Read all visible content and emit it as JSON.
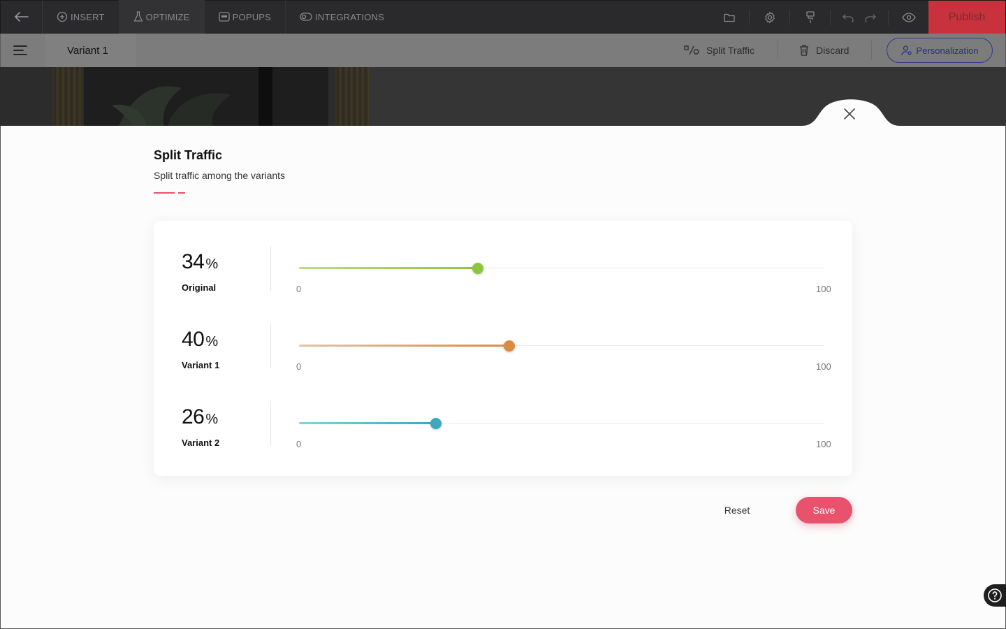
{
  "toolbar": {
    "back_icon": "arrow-left-icon",
    "nav": [
      {
        "label": "INSERT",
        "icon": "plus-circle-icon"
      },
      {
        "label": "OPTIMIZE",
        "icon": "flask-icon"
      },
      {
        "label": "POPUPS",
        "icon": "popup-window-icon"
      },
      {
        "label": "INTEGRATIONS",
        "icon": "toggle-icon"
      }
    ],
    "tools": [
      "folder-icon",
      "gear-icon",
      "paint-roller-icon",
      "undo-icon",
      "redo-icon",
      "eye-icon"
    ],
    "publish_label": "Publish"
  },
  "subbar": {
    "menu_icon": "hamburger-icon",
    "variant_label": "Variant 1",
    "split_traffic_label": "Split Traffic",
    "discard_label": "Discard",
    "personalization_label": "Personalization"
  },
  "panel": {
    "title": "Split Traffic",
    "subtitle": "Split traffic among the variants",
    "rows": [
      {
        "value": "34",
        "unit": "%",
        "name": "Original",
        "percent": 34,
        "min_label": "0",
        "max_label": "100",
        "color_start": "#b8e07c",
        "color_end": "#8cc63f"
      },
      {
        "value": "40",
        "unit": "%",
        "name": "Variant 1",
        "percent": 40,
        "min_label": "0",
        "max_label": "100",
        "color_start": "#e6c2a0",
        "color_end": "#d98a44"
      },
      {
        "value": "26",
        "unit": "%",
        "name": "Variant 2",
        "percent": 26,
        "min_label": "0",
        "max_label": "100",
        "color_start": "#7fd3e0",
        "color_end": "#3fa6bf"
      }
    ],
    "reset_label": "Reset",
    "save_label": "Save"
  },
  "colors": {
    "accent": "#e8526d",
    "toolbar_bg": "#2a2a2c",
    "publish_bg": "#c8323d"
  }
}
